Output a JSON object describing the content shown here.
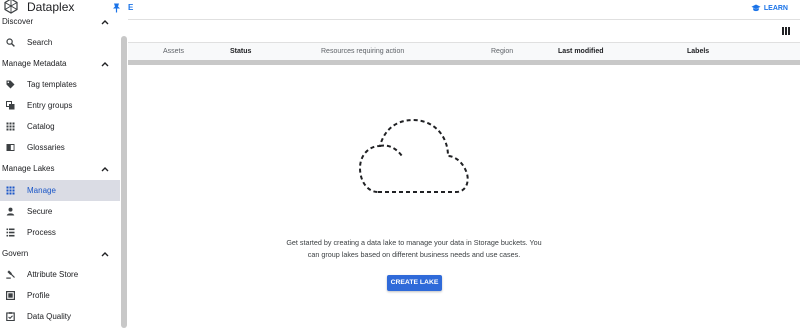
{
  "app": {
    "title": "Dataplex"
  },
  "topbar": {
    "pin_label": "E",
    "learn_label": "LEARN"
  },
  "sidebar": {
    "sections": [
      {
        "label": "Discover",
        "items": [
          {
            "label": "Search",
            "icon": "search-icon"
          }
        ]
      },
      {
        "label": "Manage Metadata",
        "items": [
          {
            "label": "Tag templates",
            "icon": "tag-icon"
          },
          {
            "label": "Entry groups",
            "icon": "entry-groups-icon"
          },
          {
            "label": "Catalog",
            "icon": "catalog-grid-icon"
          },
          {
            "label": "Glossaries",
            "icon": "book-icon"
          }
        ]
      },
      {
        "label": "Manage Lakes",
        "items": [
          {
            "label": "Manage",
            "icon": "grid-icon",
            "active": true
          },
          {
            "label": "Secure",
            "icon": "person-icon"
          },
          {
            "label": "Process",
            "icon": "list-icon"
          }
        ]
      },
      {
        "label": "Govern",
        "items": [
          {
            "label": "Attribute Store",
            "icon": "gavel-icon"
          },
          {
            "label": "Profile",
            "icon": "profile-icon"
          },
          {
            "label": "Data Quality",
            "icon": "clipboard-check-icon"
          }
        ]
      }
    ]
  },
  "table": {
    "columns": [
      {
        "label": "Assets",
        "bold": false
      },
      {
        "label": "Status",
        "bold": true
      },
      {
        "label": "Resources requiring action",
        "bold": false
      },
      {
        "label": "Region",
        "bold": false
      },
      {
        "label": "Last modified",
        "bold": true
      },
      {
        "label": "Labels",
        "bold": true
      }
    ]
  },
  "empty_state": {
    "line1": "Get started by creating a data lake to manage your data in Storage buckets. You",
    "line2": "can group lakes based on different business needs and use cases.",
    "button_label": "CREATE LAKE"
  },
  "colors": {
    "accent": "#1a73e8",
    "button": "#2f6ad9",
    "active_bg": "#dadce4"
  }
}
